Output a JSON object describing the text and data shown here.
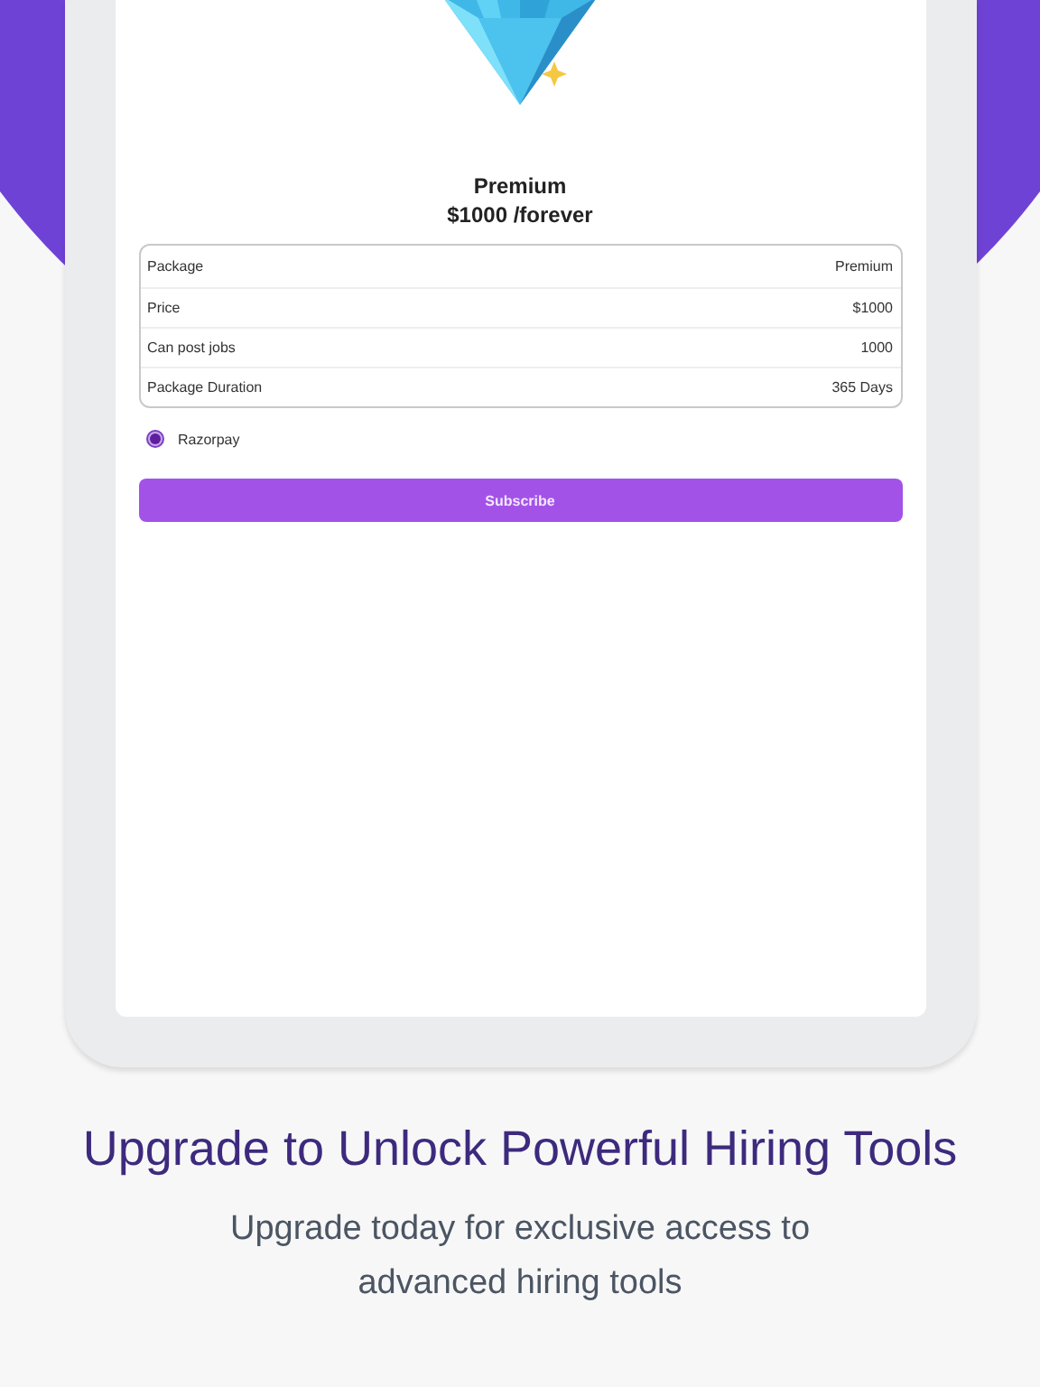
{
  "plan": {
    "title": "Premium",
    "price": "$1000 /forever"
  },
  "details": [
    {
      "label": "Package",
      "value": "Premium"
    },
    {
      "label": "Price",
      "value": "$1000"
    },
    {
      "label": "Can post jobs",
      "value": "1000"
    },
    {
      "label": "Package Duration",
      "value": "365 Days"
    }
  ],
  "payment_methods": [
    {
      "label": "Razorpay",
      "selected": true
    }
  ],
  "subscribe_button": "Subscribe",
  "headline": "Upgrade to Unlock Powerful Hiring Tools",
  "subheadline": "Upgrade today for exclusive access to advanced hiring tools"
}
